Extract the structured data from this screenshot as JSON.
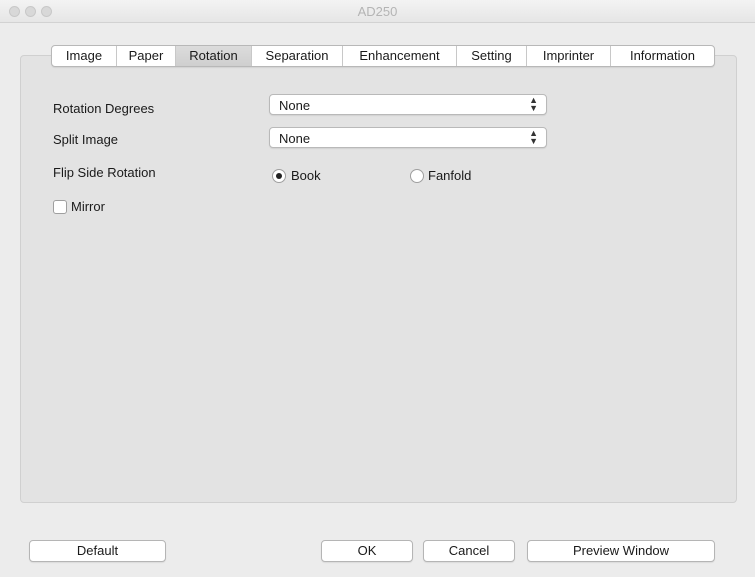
{
  "window": {
    "title": "AD250"
  },
  "tabs": [
    {
      "label": "Image",
      "active": false
    },
    {
      "label": "Paper",
      "active": false
    },
    {
      "label": "Rotation",
      "active": true
    },
    {
      "label": "Separation",
      "active": false
    },
    {
      "label": "Enhancement",
      "active": false
    },
    {
      "label": "Setting",
      "active": false
    },
    {
      "label": "Imprinter",
      "active": false
    },
    {
      "label": "Information",
      "active": false
    }
  ],
  "rotation": {
    "rotation_degrees_label": "Rotation Degrees",
    "rotation_degrees_value": "None",
    "split_image_label": "Split Image",
    "split_image_value": "None",
    "flip_side_label": "Flip Side Rotation",
    "flip_book_label": "Book",
    "flip_fanfold_label": "Fanfold",
    "flip_selected": "Book",
    "mirror_label": "Mirror",
    "mirror_checked": false
  },
  "buttons": {
    "default": "Default",
    "ok": "OK",
    "cancel": "Cancel",
    "preview": "Preview Window"
  }
}
